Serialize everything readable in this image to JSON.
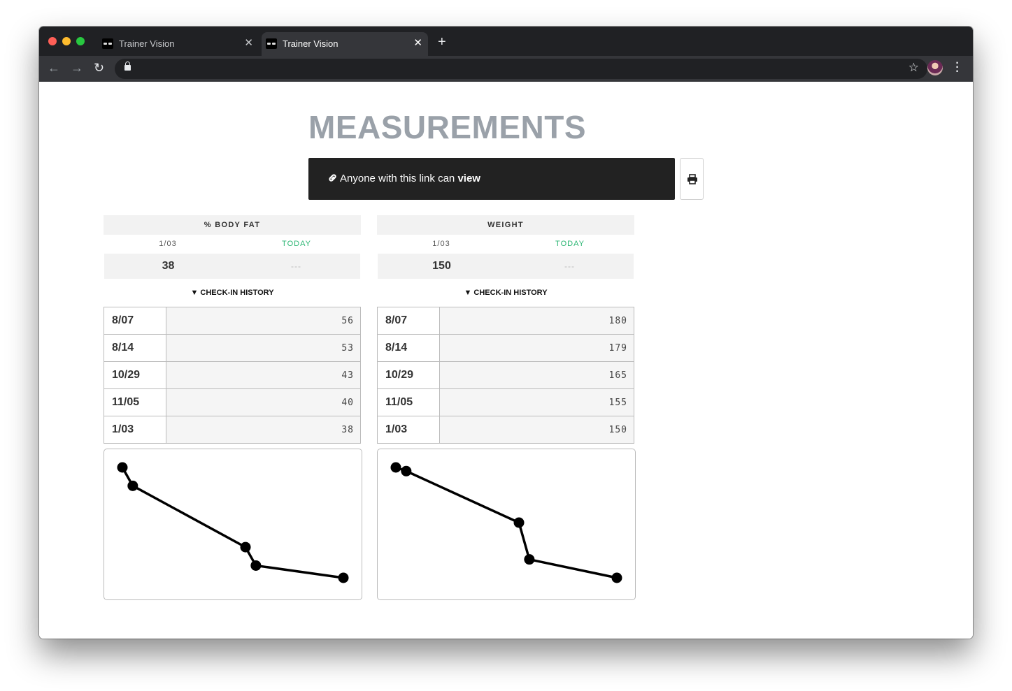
{
  "browser": {
    "tabs": [
      {
        "title": "Trainer Vision",
        "active": false
      },
      {
        "title": "Trainer Vision",
        "active": true
      }
    ]
  },
  "page": {
    "title": "MEASUREMENTS",
    "share": {
      "prefix": "Anyone with this link can",
      "permission": "view"
    }
  },
  "cards": [
    {
      "header": "% BODY FAT",
      "last_date": "1/03",
      "today_label": "TODAY",
      "last_value": "38",
      "today_value": "---",
      "history_label": "▼ CHECK-IN HISTORY",
      "history": [
        {
          "date": "8/07",
          "value": "56"
        },
        {
          "date": "8/14",
          "value": "53"
        },
        {
          "date": "10/29",
          "value": "43"
        },
        {
          "date": "11/05",
          "value": "40"
        },
        {
          "date": "1/03",
          "value": "38"
        }
      ]
    },
    {
      "header": "WEIGHT",
      "last_date": "1/03",
      "today_label": "TODAY",
      "last_value": "150",
      "today_value": "---",
      "history_label": "▼ CHECK-IN HISTORY",
      "history": [
        {
          "date": "8/07",
          "value": "180"
        },
        {
          "date": "8/14",
          "value": "179"
        },
        {
          "date": "10/29",
          "value": "165"
        },
        {
          "date": "11/05",
          "value": "155"
        },
        {
          "date": "1/03",
          "value": "150"
        }
      ]
    }
  ],
  "chart_data": [
    {
      "type": "line",
      "x": [
        "8/07",
        "8/14",
        "10/29",
        "11/05",
        "1/03"
      ],
      "values": [
        56,
        53,
        43,
        40,
        38
      ]
    },
    {
      "type": "line",
      "x": [
        "8/07",
        "8/14",
        "10/29",
        "11/05",
        "1/03"
      ],
      "values": [
        180,
        179,
        165,
        155,
        150
      ]
    }
  ]
}
